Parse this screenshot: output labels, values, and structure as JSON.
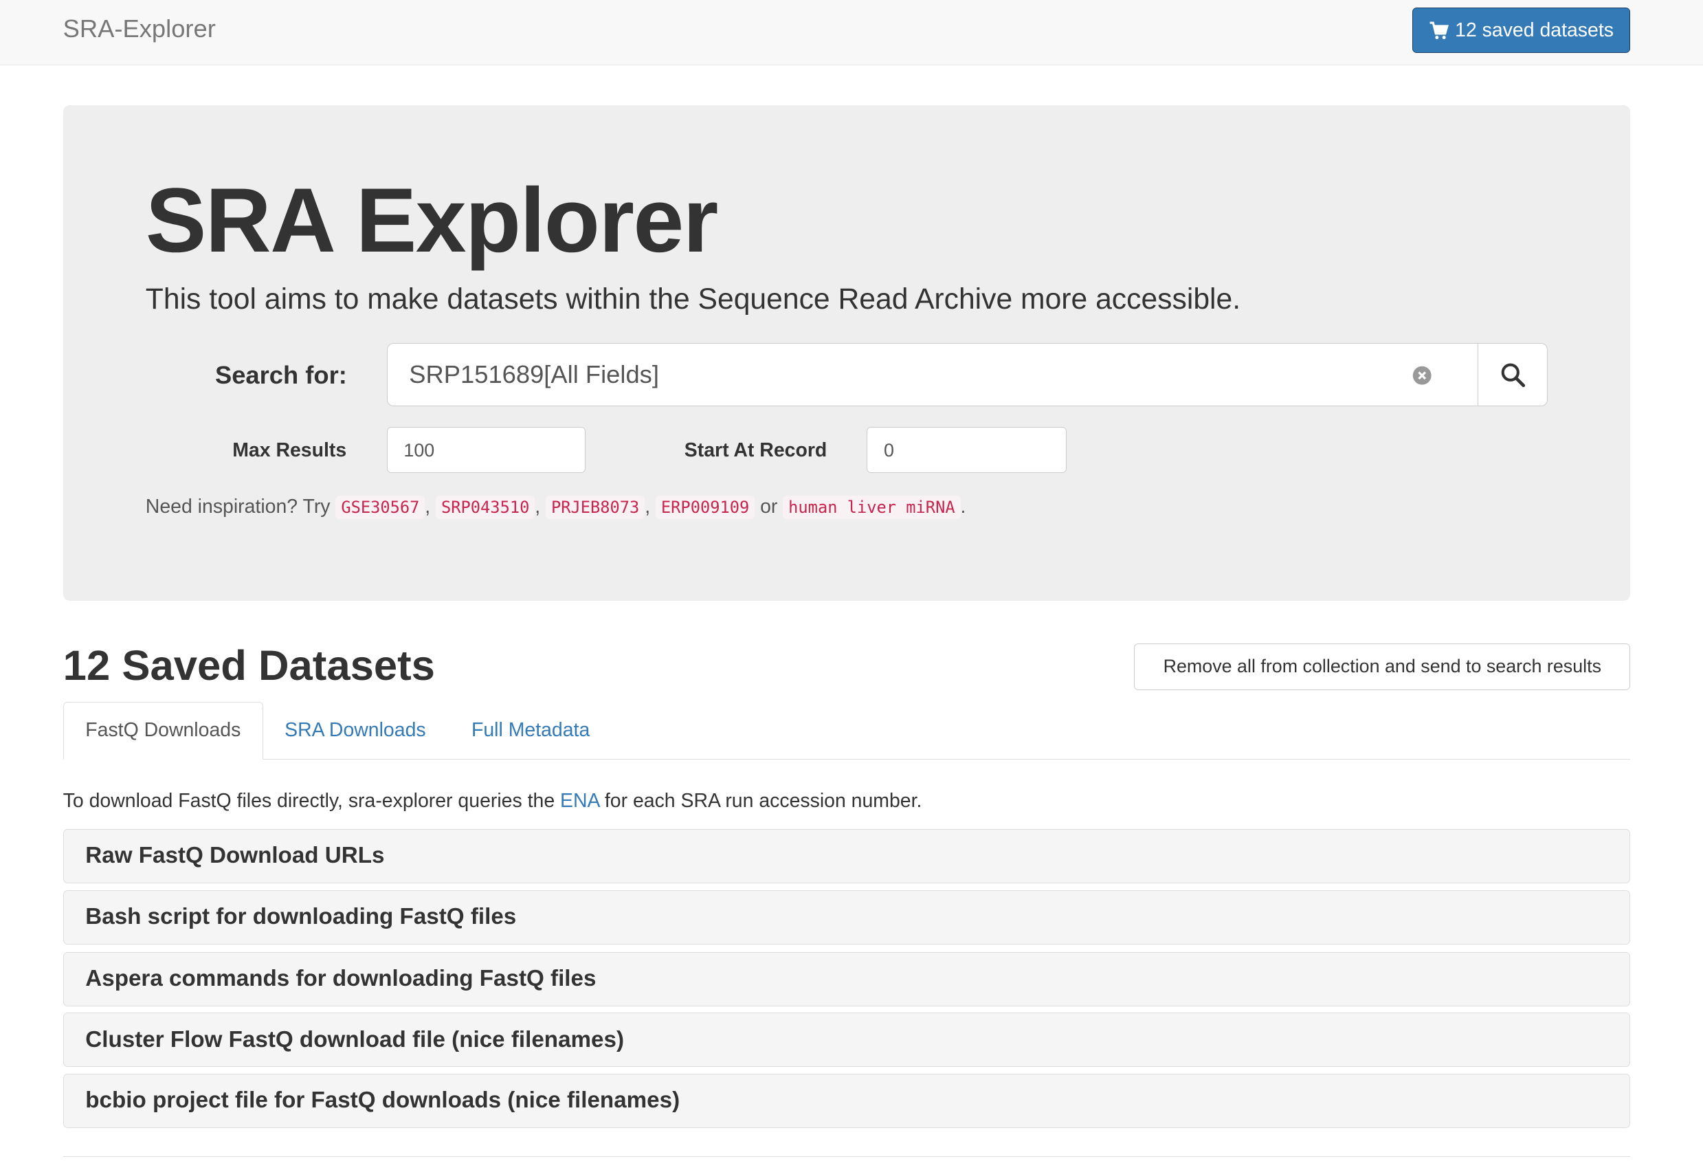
{
  "navbar": {
    "brand": "SRA-Explorer",
    "cart_label": "12 saved datasets"
  },
  "jumbotron": {
    "title": "SRA Explorer",
    "lead": "This tool aims to make datasets within the Sequence Read Archive more accessible.",
    "search_label": "Search for:",
    "search_value": "SRP151689[All Fields]",
    "max_results_label": "Max Results",
    "max_results_value": "100",
    "start_record_label": "Start At Record",
    "start_record_value": "0",
    "inspiration_prefix": "Need inspiration? Try",
    "examples": [
      "GSE30567",
      "SRP043510",
      "PRJEB8073",
      "ERP009109",
      "human liver miRNA"
    ],
    "sep_comma": ",",
    "sep_or": "or",
    "end_period": "."
  },
  "saved": {
    "title": "12 Saved Datasets",
    "remove_button": "Remove all from collection and send to search results",
    "tabs": [
      {
        "label": "FastQ Downloads",
        "active": true
      },
      {
        "label": "SRA Downloads",
        "active": false
      },
      {
        "label": "Full Metadata",
        "active": false
      }
    ],
    "description_before": "To download FastQ files directly, sra-explorer queries the",
    "description_link": "ENA",
    "description_after": "for each SRA run accession number.",
    "panels": [
      "Raw FastQ Download URLs",
      "Bash script for downloading FastQ files",
      "Aspera commands for downloading FastQ files",
      "Cluster Flow FastQ download file (nice filenames)",
      "bcbio project file for FastQ downloads (nice filenames)"
    ]
  },
  "colors": {
    "primary": "#337ab7",
    "code_text": "#c7254e",
    "jumbotron_bg": "#eeeeee"
  },
  "icons": {
    "cart": "shopping-cart-icon",
    "search": "search-icon",
    "clear": "clear-icon"
  }
}
